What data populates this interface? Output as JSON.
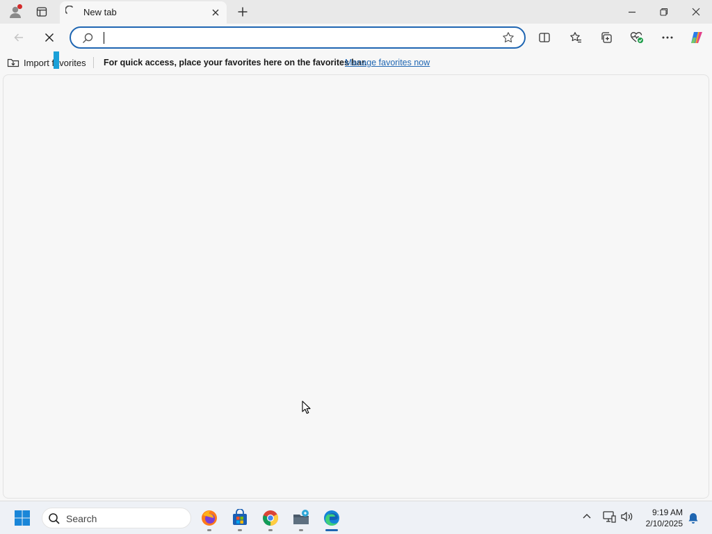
{
  "tab": {
    "title": "New tab"
  },
  "address_bar": {
    "value": "",
    "placeholder": ""
  },
  "favorites_bar": {
    "import_label": "Import favorites",
    "message": "For quick access, place your favorites here on the favorites bar.",
    "link": "Manage favorites now"
  },
  "taskbar": {
    "search_label": "Search",
    "apps": [
      "firefox-icon",
      "microsoft-store-icon",
      "chrome-icon",
      "file-explorer-icon",
      "edge-icon"
    ],
    "active_app": "edge-icon"
  },
  "clock": {
    "time": "9:19 AM",
    "date": "2/10/2025"
  },
  "colors": {
    "accent": "#1f66b2",
    "chrome": "#e9e9e9",
    "page": "#f7f7f7",
    "notification_dot": "#d42a2a"
  }
}
